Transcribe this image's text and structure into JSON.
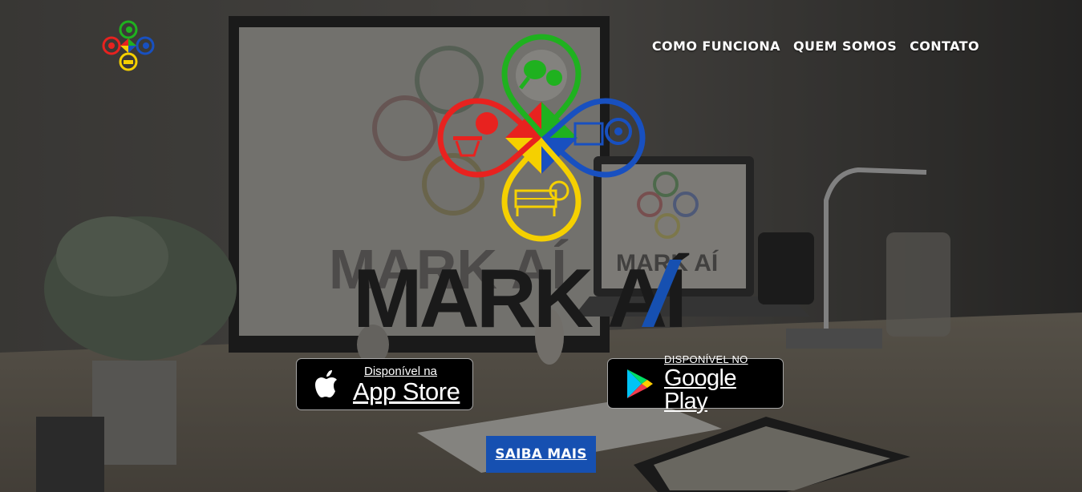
{
  "nav": {
    "items": [
      {
        "label": "COMO FUNCIONA"
      },
      {
        "label": "QUEM SOMOS"
      },
      {
        "label": "CONTATO"
      }
    ]
  },
  "hero": {
    "brand_text": "MARK AÍ",
    "logo_pins": [
      "ping-pong",
      "basketball",
      "soccer",
      "volleyball"
    ],
    "pin_colors": {
      "top": "#1fb11f",
      "left": "#e8221f",
      "right": "#1850c0",
      "bottom": "#f5d000"
    }
  },
  "app_store": {
    "small": "Disponível na",
    "big": "App Store"
  },
  "google_play": {
    "small": "DISPONÍVEL NO",
    "big": "Google Play"
  },
  "cta": {
    "label": "SAIBA MAIS"
  },
  "colors": {
    "cta_bg": "#1650b1",
    "brand_dark": "#1a1a1a",
    "brand_accent": "#1650b1"
  }
}
